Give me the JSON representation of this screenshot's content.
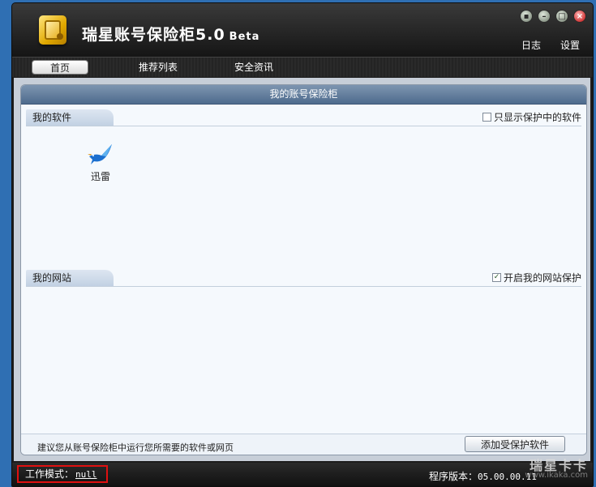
{
  "window": {
    "title": "瑞星账号保险柜5.0",
    "beta": "Beta",
    "top_links": {
      "log": "日志",
      "settings": "设置"
    }
  },
  "nav": {
    "tabs": [
      {
        "label": "首页"
      },
      {
        "label": "推荐列表"
      },
      {
        "label": "安全资讯"
      }
    ]
  },
  "panel": {
    "title": "我的账号保险柜",
    "software_section": {
      "label": "我的软件",
      "option": "只显示保护中的软件",
      "option_checked": false,
      "apps": [
        {
          "name": "迅雷"
        }
      ]
    },
    "website_section": {
      "label": "我的网站",
      "option": "开启我的网站保护",
      "option_checked": true
    },
    "tip": "建议您从账号保险柜中运行您所需要的软件或网页",
    "add_button": "添加受保护软件"
  },
  "status": {
    "mode_label": "工作模式：",
    "mode_value": "null",
    "version_label": "程序版本：",
    "version_value": "05.00.00.11"
  },
  "watermark": {
    "brand": "瑞星卡卡",
    "url": "www.ikaka.com"
  },
  "colors": {
    "header": "#1c1c1c",
    "panel_title": "#5a7699",
    "highlight_border": "#e01010"
  }
}
